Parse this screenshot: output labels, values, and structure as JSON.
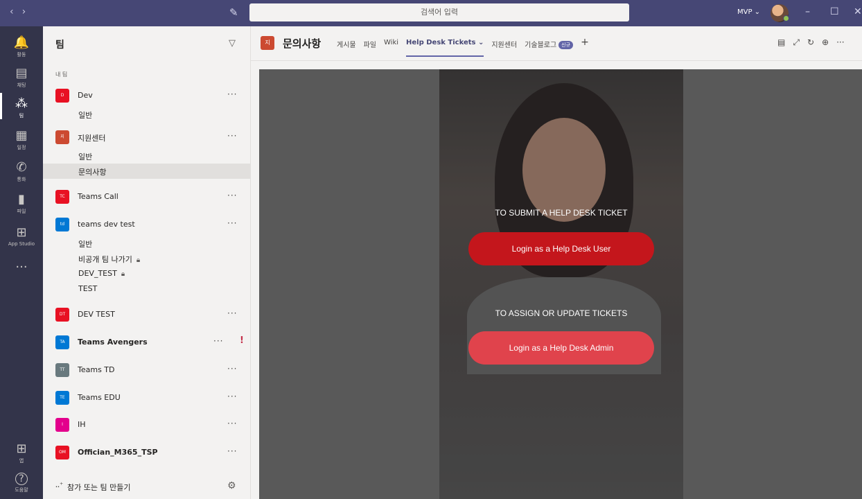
{
  "titlebar": {
    "search_placeholder": "검색어 입력",
    "profile_label": "MVP ⌄",
    "nav_back": "‹",
    "nav_forward": "›",
    "compose_icon": "compose-icon",
    "min": "–",
    "max": "☐",
    "close": "✕"
  },
  "rail": {
    "items": [
      {
        "label": "활동",
        "icon": "bell-icon",
        "glyph": "🔔"
      },
      {
        "label": "채팅",
        "icon": "chat-icon",
        "glyph": "▤"
      },
      {
        "label": "팀",
        "icon": "teams-icon",
        "glyph": "⁂"
      },
      {
        "label": "일정",
        "icon": "calendar-icon",
        "glyph": "▦"
      },
      {
        "label": "통화",
        "icon": "phone-icon",
        "glyph": "✆"
      },
      {
        "label": "파일",
        "icon": "file-icon",
        "glyph": "▮"
      },
      {
        "label": "App Studio",
        "icon": "app-studio-icon",
        "glyph": "⊞"
      },
      {
        "label": "",
        "icon": "more-apps-icon",
        "glyph": "···"
      }
    ],
    "bottom": [
      {
        "label": "앱",
        "icon": "apps-icon",
        "glyph": "⊞"
      },
      {
        "label": "도움말",
        "icon": "help-icon",
        "glyph": "?"
      }
    ]
  },
  "teams_panel": {
    "title": "팀",
    "section_label": "내 팀",
    "teams": [
      {
        "badge": "D",
        "badge_color": "#e81123",
        "name": "Dev",
        "channels": [
          "일반"
        ]
      },
      {
        "badge": "지",
        "badge_color": "#cc4a31",
        "name": "지원센터",
        "channels": [
          "일반",
          "문의사항"
        ]
      },
      {
        "badge": "TC",
        "badge_color": "#e81123",
        "name": "Teams Call",
        "channels": []
      },
      {
        "badge": "td",
        "badge_color": "#0078d4",
        "name": "teams dev test",
        "channels": [
          "일반",
          "비공개 팀 나가기",
          "DEV_TEST",
          "TEST"
        ]
      },
      {
        "badge": "DT",
        "badge_color": "#e81123",
        "name": "DEV TEST",
        "channels": []
      },
      {
        "badge": "TA",
        "badge_color": "#0078d4",
        "name": "Teams Avengers",
        "channels": []
      },
      {
        "badge": "TT",
        "badge_color": "#69797e",
        "name": "Teams TD",
        "channels": []
      },
      {
        "badge": "TE",
        "badge_color": "#0078d4",
        "name": "Teams EDU",
        "channels": []
      },
      {
        "badge": "I",
        "badge_color": "#e3008c",
        "name": "IH",
        "channels": []
      },
      {
        "badge": "OM",
        "badge_color": "#e81123",
        "name": "Offician_M365_TSP",
        "channels": []
      }
    ],
    "more": "···",
    "alert": "!",
    "lock": "🔒",
    "footer_label": "참가 또는 팀 만들기"
  },
  "channel_header": {
    "badge": "지",
    "title": "문의사항",
    "tabs": [
      "게시물",
      "파일",
      "Wiki",
      "Help Desk Tickets ⌄",
      "지원센터",
      "기술블로그"
    ],
    "new_badge": "신규",
    "add": "+",
    "icons": [
      "conversation-icon",
      "expand-icon",
      "refresh-icon",
      "globe-icon",
      "more-icon"
    ],
    "icon_glyphs": [
      "▤",
      "⤢",
      "↻",
      "⊕",
      "···"
    ]
  },
  "helpdesk": {
    "submit_label": "TO SUBMIT A HELP DESK TICKET",
    "user_button": "Login as a Help Desk User",
    "assign_label": "TO ASSIGN OR UPDATE TICKETS",
    "admin_button": "Login as a Help Desk Admin"
  }
}
